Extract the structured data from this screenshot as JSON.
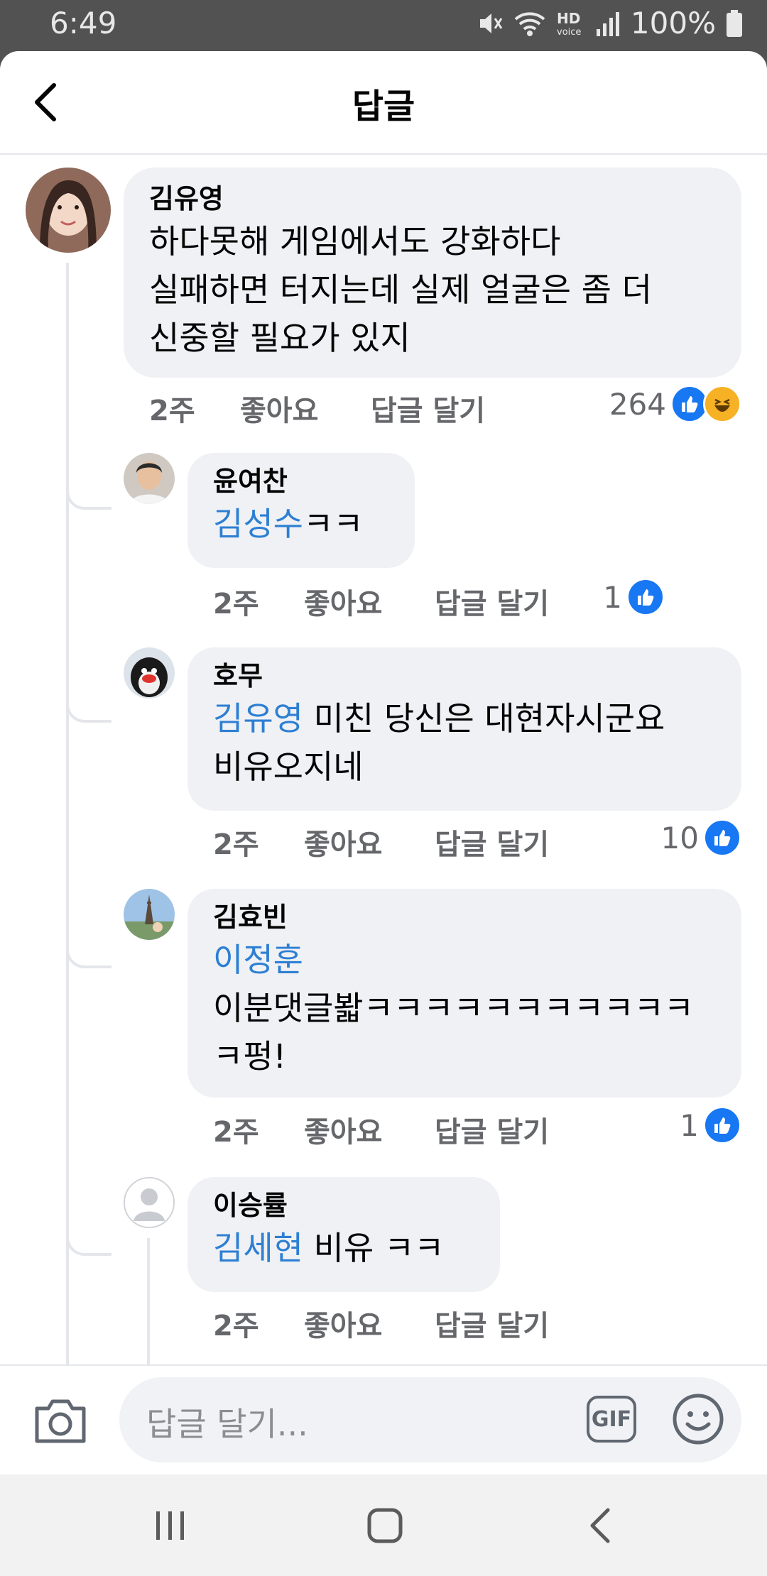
{
  "status_bar": {
    "time": "6:49",
    "battery": "100%",
    "icons": [
      "mute-icon",
      "wifi-icon",
      "hd-voice-icon",
      "signal-icon",
      "battery-icon"
    ]
  },
  "header": {
    "title": "답글",
    "back_icon": "chevron-left-icon"
  },
  "meta_labels": {
    "time": "2주",
    "like": "좋아요",
    "reply": "답글 달기"
  },
  "comments": [
    {
      "author": "김유영",
      "mention": "",
      "text": "하다못해 게임에서도 강화하다\n실패하면 터지는데 실제 얼굴은 좀 더\n신중할 필요가 있지",
      "reaction_count": "264",
      "reactions": [
        "like",
        "haha"
      ]
    },
    {
      "author": "윤여찬",
      "mention": "김성수",
      "text": "ㅋㅋ",
      "reaction_count": "1",
      "reactions": [
        "like"
      ]
    },
    {
      "author": "호무",
      "mention": "김유영",
      "text": " 미친 당신은 대현자시군요\n비유오지네",
      "reaction_count": "10",
      "reactions": [
        "like"
      ]
    },
    {
      "author": "김효빈",
      "mention": "이정훈",
      "text": "\n이분댓글봛ㅋㅋㅋㅋㅋㅋㅋㅋㅋㅋㅋ\nㅋ펑!",
      "reaction_count": "1",
      "reactions": [
        "like"
      ]
    },
    {
      "author": "이승률",
      "mention": "김세현",
      "text": " 비유 ㅋㅋ",
      "reaction_count": "",
      "reactions": []
    }
  ],
  "composer": {
    "placeholder": "답글 달기...",
    "gif_label": "GIF",
    "camera_icon": "camera-icon",
    "emoji_icon": "smiley-icon"
  },
  "navbar": {
    "icons": [
      "recent-apps-icon",
      "home-icon",
      "back-icon"
    ]
  }
}
